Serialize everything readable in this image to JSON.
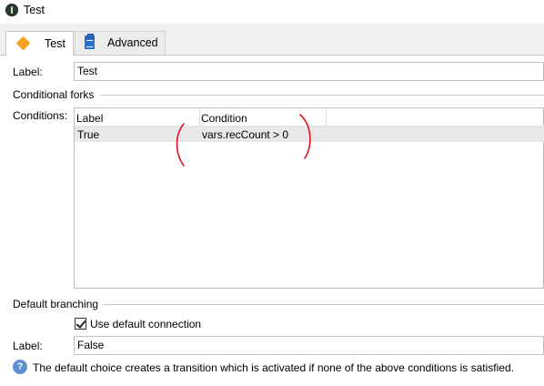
{
  "window": {
    "title": "Test"
  },
  "tabs": [
    {
      "label": "Test",
      "icon": "diamond-icon",
      "active": true
    },
    {
      "label": "Advanced",
      "icon": "clipboard-icon",
      "active": false
    }
  ],
  "form": {
    "label_caption": "Label:",
    "label_value": "Test",
    "conditional_forks_title": "Conditional forks",
    "conditions_caption": "Conditions:",
    "conditions_columns": [
      "Label",
      "Condition"
    ],
    "conditions_rows": [
      {
        "label": "True",
        "condition": "vars.recCount > 0"
      }
    ],
    "default_branching_title": "Default branching",
    "use_default_connection_label": "Use default connection",
    "use_default_connection_checked": true,
    "default_label_caption": "Label:",
    "default_label_value": "False",
    "info_text": "The default choice creates a transition which is activated if none of the above conditions is satisfied."
  },
  "colors": {
    "tab_diamond": "#f3a11f",
    "clipboard": "#2a6fd0",
    "annotation_red": "#e0121b",
    "info_icon": "#5e8fd0"
  }
}
